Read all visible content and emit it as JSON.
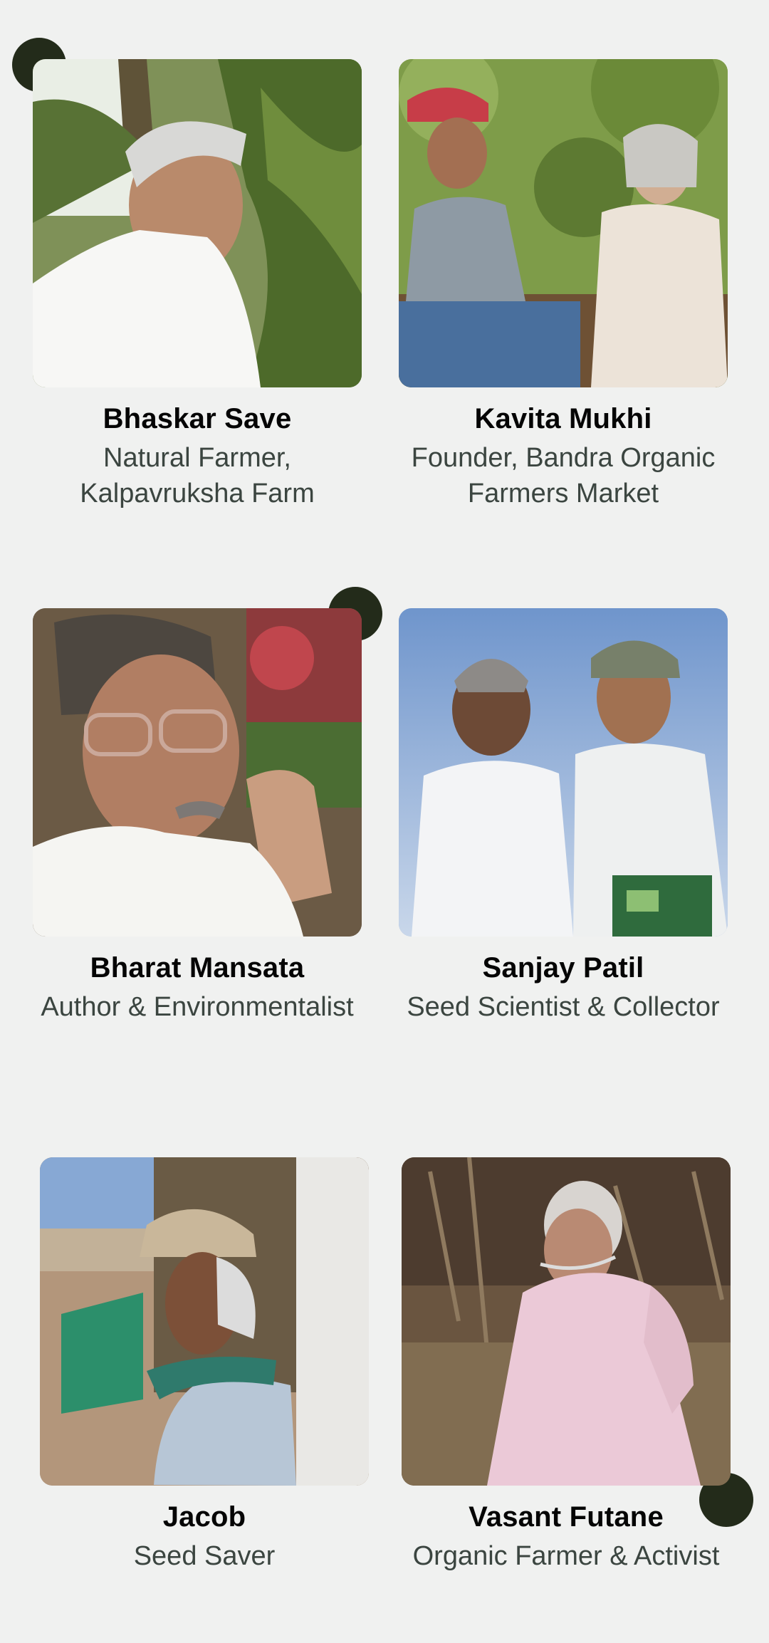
{
  "people": [
    {
      "name": "Bhaskar Save",
      "role": "Natural Farmer, Kalpavruksha Farm",
      "photo_alt": "Portrait of Bhaskar Save"
    },
    {
      "name": "Kavita Mukhi",
      "role": "Founder, Bandra Organic Farmers Market",
      "photo_alt": "Kavita Mukhi in a garden"
    },
    {
      "name": "Bharat Mansata",
      "role": "Author & Environmentalist",
      "photo_alt": "Portrait of Bharat Mansata"
    },
    {
      "name": "Sanjay Patil",
      "role": "Seed Scientist & Collector",
      "photo_alt": "Sanjay Patil with a companion"
    },
    {
      "name": "Jacob",
      "role": "Seed Saver",
      "photo_alt": "Jacob in a farm field"
    },
    {
      "name": "Vasant Futane",
      "role": "Organic Farmer & Activist",
      "photo_alt": "Vasant Futane in a field"
    }
  ],
  "colors": {
    "background": "#f0f1f0",
    "accent_dot": "#232b1a",
    "name_text": "#050505",
    "role_text": "#3b4540"
  }
}
